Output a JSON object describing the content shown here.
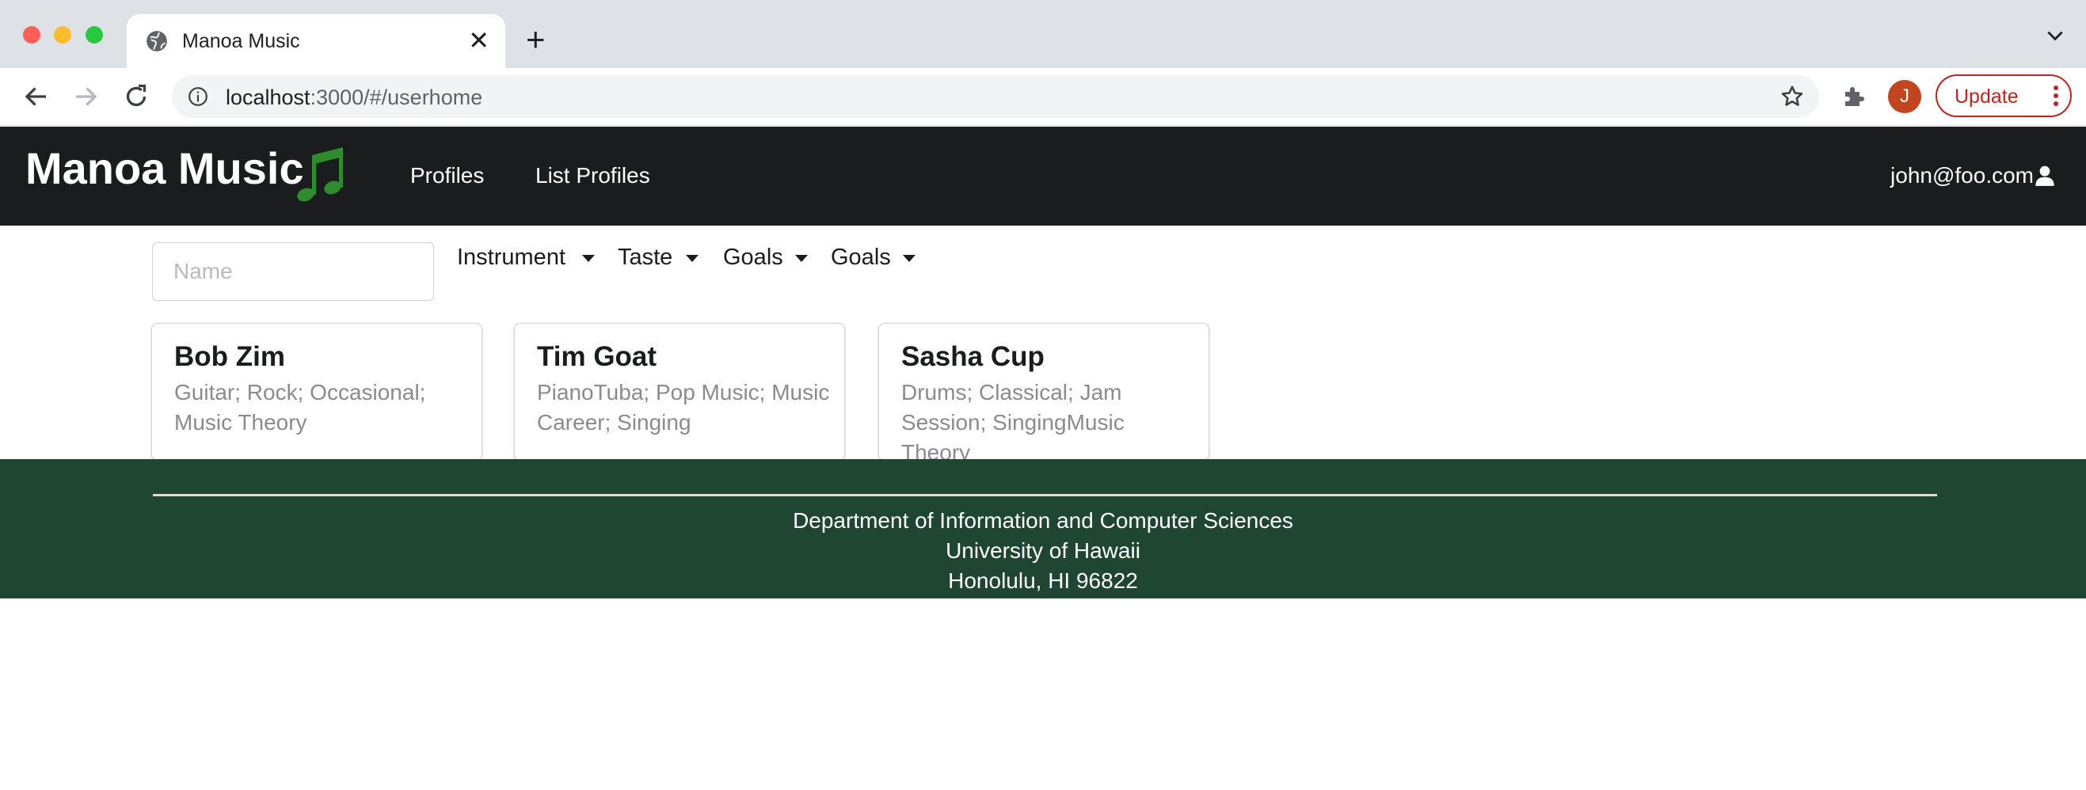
{
  "browser": {
    "tab_title": "Manoa Music",
    "url_host": "localhost",
    "url_rest": ":3000/#/userhome",
    "avatar_initial": "J",
    "update_label": "Update"
  },
  "navbar": {
    "brand": "Manoa Music",
    "items": [
      {
        "label": "Profiles"
      },
      {
        "label": "List Profiles"
      }
    ],
    "user_email": "john@foo.com",
    "brand_icon": "music-note-icon",
    "note_color": "#2e8b2e",
    "background": "#1b1c1d"
  },
  "filters": {
    "name_placeholder": "Name",
    "dropdowns": [
      {
        "label": "Instrument"
      },
      {
        "label": "Taste"
      },
      {
        "label": "Goals"
      },
      {
        "label": "Goals"
      }
    ]
  },
  "cards": [
    {
      "name": "Bob Zim",
      "meta": "Guitar; Rock; Occasional; Music Theory"
    },
    {
      "name": "Tim Goat",
      "meta": "PianoTuba; Pop Music; Music Career; Singing"
    },
    {
      "name": "Sasha Cup",
      "meta": "Drums; Classical; Jam Session; SingingMusic Theory"
    }
  ],
  "footer": {
    "lines": [
      "Department of Information and Computer Sciences",
      "University of Hawaii",
      "Honolulu, HI 96822"
    ],
    "background": "#1e4632"
  }
}
